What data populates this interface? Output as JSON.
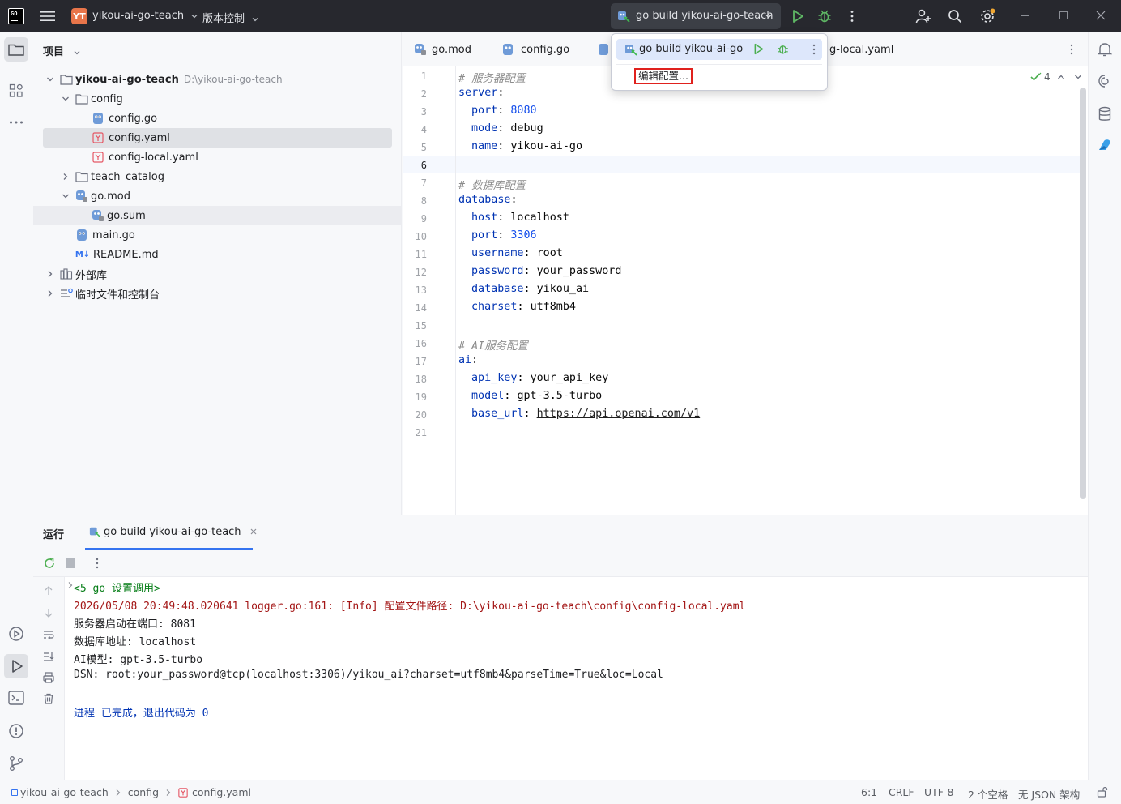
{
  "titlebar": {
    "project_badge": "YT",
    "project_name": "yikou-ai-go-teach",
    "vcs": "版本控制",
    "run_config": "go build yikou-ai-go-teach"
  },
  "project_panel": {
    "title": "项目",
    "tree": [
      {
        "label": "yikou-ai-go-teach",
        "path": "D:\\yikou-ai-go-teach",
        "icon": "folder-icon"
      },
      {
        "label": "config",
        "icon": "folder-icon"
      },
      {
        "label": "config.go",
        "icon": "go-file-icon"
      },
      {
        "label": "config.yaml",
        "icon": "yaml-file-icon"
      },
      {
        "label": "config-local.yaml",
        "icon": "yaml-file-icon"
      },
      {
        "label": "teach_catalog",
        "icon": "folder-icon"
      },
      {
        "label": "go.mod",
        "icon": "go-mod-icon"
      },
      {
        "label": "go.sum",
        "icon": "go-mod-icon"
      },
      {
        "label": "main.go",
        "icon": "go-file-icon"
      },
      {
        "label": "README.md",
        "icon": "markdown-icon"
      },
      {
        "label": "外部库",
        "icon": "library-icon"
      },
      {
        "label": "临时文件和控制台",
        "icon": "scratch-icon"
      }
    ]
  },
  "tabs": [
    {
      "label": "go.mod"
    },
    {
      "label": "config.go"
    },
    {
      "label": "g-local.yaml"
    }
  ],
  "popup": {
    "run_config_label": "go build yikou-ai-go-t",
    "edit_config": "编辑配置..."
  },
  "editor": {
    "inspection_count": "4",
    "line_numbers": [
      "1",
      "2",
      "3",
      "4",
      "5",
      "6",
      "7",
      "8",
      "9",
      "10",
      "11",
      "12",
      "13",
      "14",
      "15",
      "16",
      "17",
      "18",
      "19",
      "20",
      "21"
    ],
    "lines": [
      {
        "comment": "# 服务器配置"
      },
      {
        "key": "server",
        "sep": ":"
      },
      {
        "indent": true,
        "key": "port",
        "sep": ": ",
        "value": "8080",
        "vtype": "n"
      },
      {
        "indent": true,
        "key": "mode",
        "sep": ": ",
        "value": "debug",
        "vtype": "s"
      },
      {
        "indent": true,
        "key": "name",
        "sep": ": ",
        "value": "yikou-ai-go",
        "vtype": "s"
      },
      {},
      {
        "comment": "# 数据库配置"
      },
      {
        "key": "database",
        "sep": ":"
      },
      {
        "indent": true,
        "key": "host",
        "sep": ": ",
        "value": "localhost",
        "vtype": "s"
      },
      {
        "indent": true,
        "key": "port",
        "sep": ": ",
        "value": "3306",
        "vtype": "n"
      },
      {
        "indent": true,
        "key": "username",
        "sep": ": ",
        "value": "root",
        "vtype": "s"
      },
      {
        "indent": true,
        "key": "password",
        "sep": ": ",
        "value": "your_password",
        "vtype": "s"
      },
      {
        "indent": true,
        "key": "database",
        "sep": ": ",
        "value": "yikou_ai",
        "vtype": "s"
      },
      {
        "indent": true,
        "key": "charset",
        "sep": ": ",
        "value": "utf8mb4",
        "vtype": "s"
      },
      {},
      {
        "comment": "# AI服务配置"
      },
      {
        "key": "ai",
        "sep": ":"
      },
      {
        "indent": true,
        "key": "api_key",
        "sep": ": ",
        "value": "your_api_key",
        "vtype": "s"
      },
      {
        "indent": true,
        "key": "model",
        "sep": ": ",
        "value": "gpt-3.5-turbo",
        "vtype": "s"
      },
      {
        "indent": true,
        "key": "base_url",
        "sep": ": ",
        "value": "https://api.openai.com/v1",
        "vtype": "u"
      },
      {}
    ]
  },
  "run_panel": {
    "title": "运行",
    "tab": "go build yikou-ai-go-teach",
    "output": [
      {
        "text": "<5 go 设置调用>",
        "color": "#067d17"
      },
      {
        "text": "2026/05/08 20:49:48.020641 logger.go:161: [Info] 配置文件路径: D:\\yikou-ai-go-teach\\config\\config-local.yaml",
        "color": "#a31515"
      },
      {
        "text": "服务器启动在端口: 8081",
        "color": "#1e1f22"
      },
      {
        "text": "数据库地址: localhost",
        "color": "#1e1f22"
      },
      {
        "text": "AI模型: gpt-3.5-turbo",
        "color": "#1e1f22"
      },
      {
        "text": "DSN: root:your_password@tcp(localhost:3306)/yikou_ai?charset=utf8mb4&parseTime=True&loc=Local",
        "color": "#1e1f22"
      },
      {
        "text": "",
        "color": "#1e1f22"
      },
      {
        "text": "进程 已完成，退出代码为 0",
        "color": "#0033b3"
      }
    ]
  },
  "statusbar": {
    "breadcrumb": [
      "yikou-ai-go-teach",
      "config",
      "config.yaml"
    ],
    "position": "6:1",
    "line_sep": "CRLF",
    "encoding": "UTF-8",
    "indent": "2 个空格",
    "schema": "无 JSON 架构"
  },
  "colors": {
    "titlebar_bg": "#27282e",
    "accent": "#3574f0",
    "run_green": "#4caf50",
    "highlight_red": "#e0211d"
  }
}
